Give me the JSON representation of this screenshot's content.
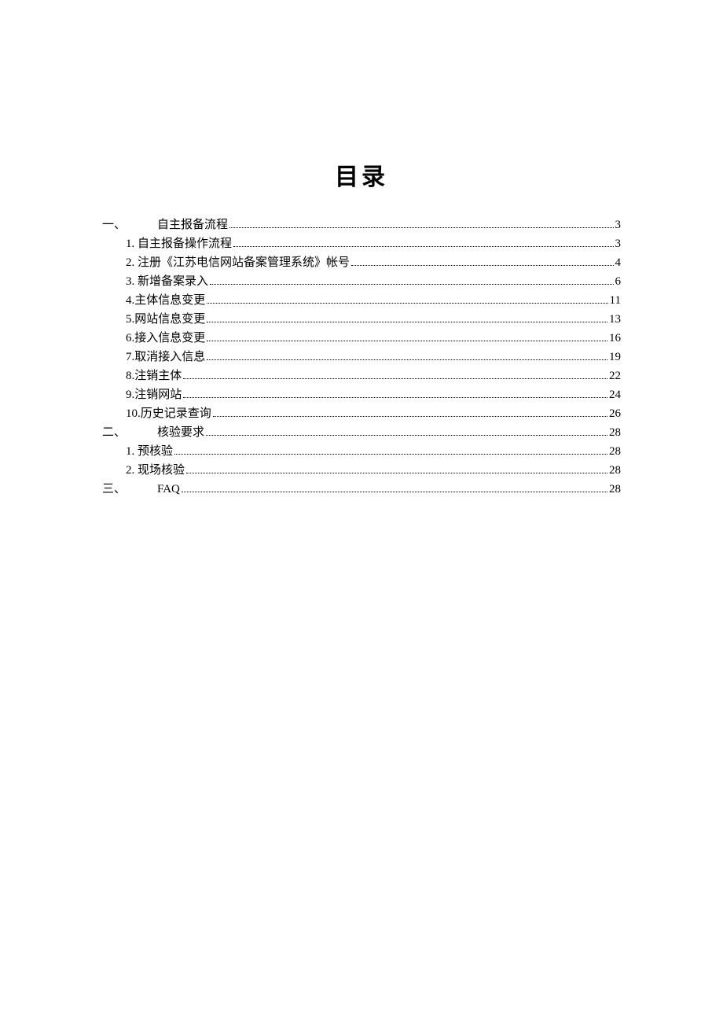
{
  "title": "目录",
  "entries": [
    {
      "type": "section",
      "num": "一、",
      "label": "自主报备流程",
      "page": "3"
    },
    {
      "type": "sub",
      "label": "1. 自主报备操作流程",
      "page": "3"
    },
    {
      "type": "sub",
      "label": "2. 注册《江苏电信网站备案管理系统》帐号",
      "page": "4"
    },
    {
      "type": "sub",
      "label": "3. 新增备案录入",
      "page": "6"
    },
    {
      "type": "sub",
      "label": "4.主体信息变更",
      "page": "11"
    },
    {
      "type": "sub",
      "label": "5.网站信息变更",
      "page": "13"
    },
    {
      "type": "sub",
      "label": "6.接入信息变更",
      "page": "16"
    },
    {
      "type": "sub",
      "label": "7.取消接入信息",
      "page": "19"
    },
    {
      "type": "sub",
      "label": "8.注销主体",
      "page": "22"
    },
    {
      "type": "sub",
      "label": "9.注销网站",
      "page": "24"
    },
    {
      "type": "sub",
      "label": "10.历史记录查询",
      "page": "26"
    },
    {
      "type": "section",
      "num": "二、",
      "label": "核验要求",
      "page": "28"
    },
    {
      "type": "sub",
      "label": "1. 预核验",
      "page": "28"
    },
    {
      "type": "sub",
      "label": "2. 现场核验",
      "page": "28"
    },
    {
      "type": "section",
      "num": "三、",
      "label": "FAQ",
      "page": "28"
    }
  ]
}
